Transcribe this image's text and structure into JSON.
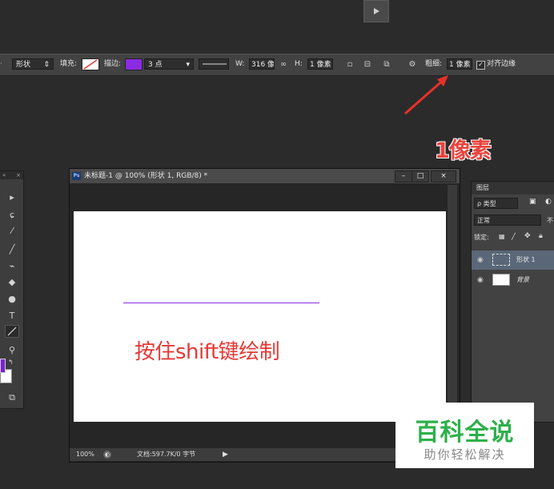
{
  "top": {
    "play_icon": "play-icon"
  },
  "options_bar": {
    "tool_mode": "形状",
    "fill_label": "填充:",
    "stroke_label": "描边:",
    "stroke_color": "#8a2be2",
    "stroke_size": "3 点",
    "w_label": "W:",
    "w_value": "316 像",
    "h_label": "H:",
    "h_value": "1 像素",
    "weight_label": "粗细:",
    "weight_value": "1 像素",
    "align_edges_label": "对齐边缘",
    "align_edges_checked": true
  },
  "annotation": {
    "text": "1像素",
    "color": "#e8443e"
  },
  "toolbox": {
    "tools": [
      "move-icon",
      "lasso-icon",
      "eyedropper-icon",
      "brush-icon",
      "clone-stamp-icon",
      "paint-bucket-icon",
      "dodge-icon",
      "type-icon",
      "line-icon",
      "zoom-icon"
    ],
    "active_tool": "line-icon",
    "type_glyph": "T",
    "foreground_color": "#7b22d2",
    "background_color": "#ffffff"
  },
  "document": {
    "title": "未标题-1 @ 100% (形状 1, RGB/8) *",
    "ps_badge": "Ps",
    "canvas_text": "按住shift键绘制",
    "line_color": "#8a2be2",
    "status_zoom": "100%",
    "status_doc": "文档:597.7K/0 字节"
  },
  "layers_panel": {
    "tab": "图层",
    "filter": "ρ 类型",
    "blend_mode": "正常",
    "opacity_label": "不",
    "lock_label": "锁定:",
    "layers": [
      {
        "name": "形状 1",
        "selected": true
      },
      {
        "name": "背景",
        "selected": false
      }
    ]
  },
  "watermark": {
    "title": "百科全说",
    "subtitle": "助你轻松解决"
  }
}
